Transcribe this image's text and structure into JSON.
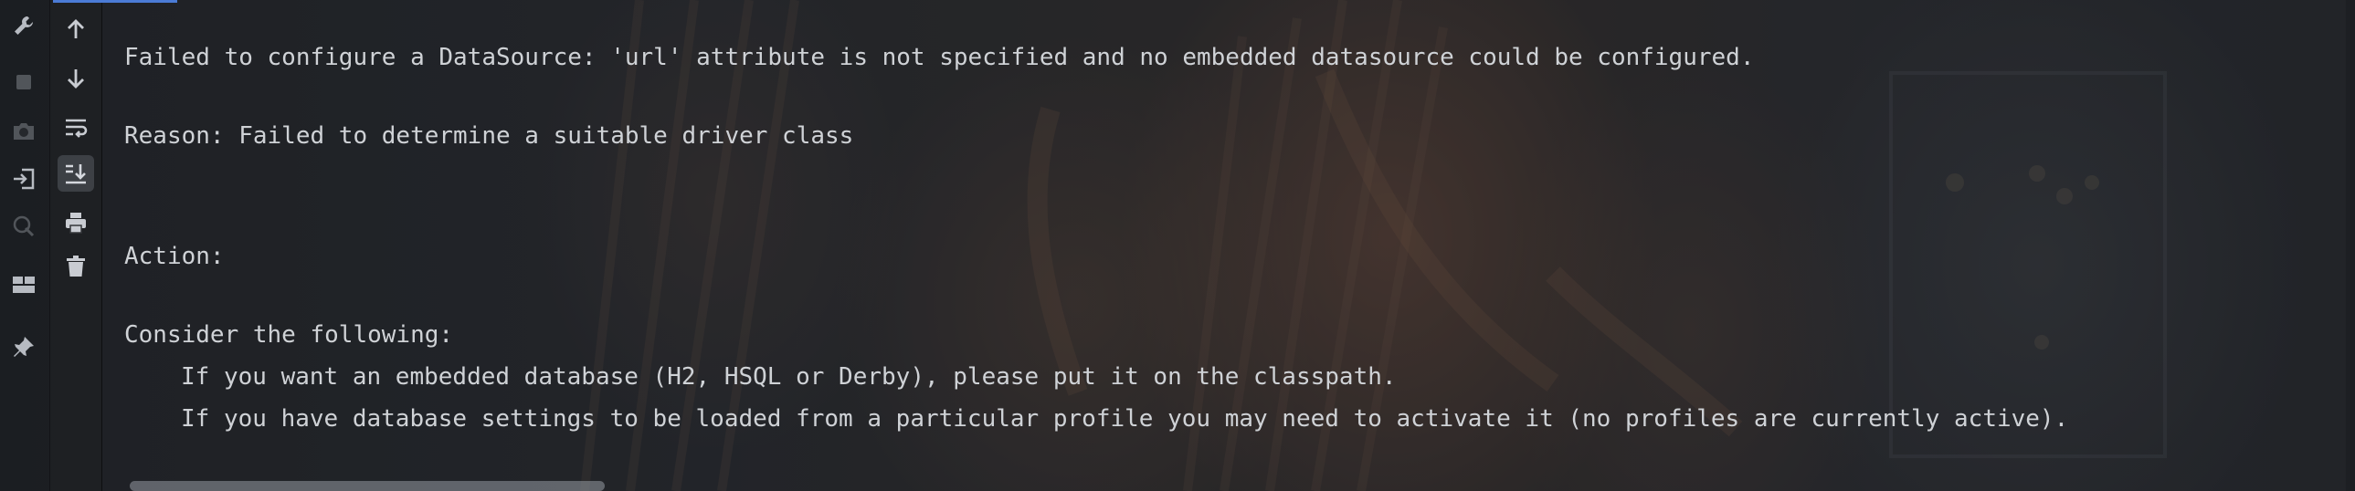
{
  "toolbar_left": {
    "items": [
      {
        "name": "wrench-icon"
      },
      {
        "name": "stop-icon",
        "disabled": true
      },
      {
        "name": "camera-icon",
        "disabled": true
      },
      {
        "name": "login-icon"
      },
      {
        "name": "debug-attach-icon",
        "disabled": true
      },
      {
        "name": "layout-icon"
      },
      {
        "name": "pin-icon"
      }
    ]
  },
  "toolbar_console": {
    "items": [
      {
        "name": "up-arrow-icon"
      },
      {
        "name": "down-arrow-icon"
      },
      {
        "name": "soft-wrap-icon"
      },
      {
        "name": "scroll-to-end-icon",
        "active": true
      },
      {
        "name": "print-icon"
      },
      {
        "name": "trash-icon"
      }
    ]
  },
  "console": {
    "line_1": "Failed to configure a DataSource: 'url' attribute is not specified and no embedded datasource could be configured.",
    "line_2": "Reason: Failed to determine a suitable driver class",
    "line_3": "Action:",
    "line_4": "Consider the following:",
    "line_5": "If you want an embedded database (H2, HSQL or Derby), please put it on the classpath.",
    "line_6": "If you have database settings to be loaded from a particular profile you may need to activate it (no profiles are currently active)."
  },
  "colors": {
    "text": "#cfd2d6",
    "accent": "#4b7bd6",
    "background": "#2b2d30"
  }
}
